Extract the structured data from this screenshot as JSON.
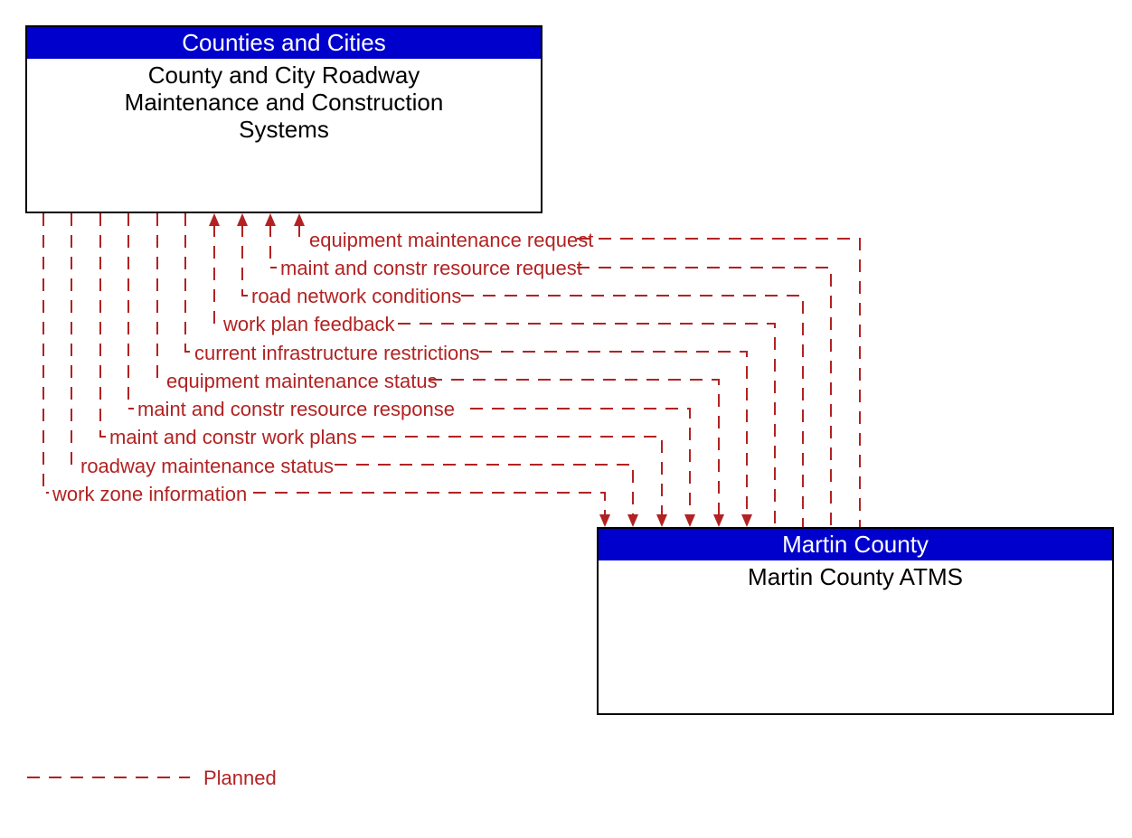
{
  "nodes": {
    "top": {
      "header": "Counties and Cities",
      "body_line1": "County and City Roadway",
      "body_line2": "Maintenance and Construction",
      "body_line3": "Systems"
    },
    "bottom": {
      "header": "Martin County",
      "body_line1": "Martin County ATMS"
    }
  },
  "flows_to_top": [
    "equipment maintenance request",
    "maint and constr resource request",
    "road network conditions",
    "work plan feedback"
  ],
  "flows_to_bottom": [
    "current infrastructure restrictions",
    "equipment maintenance status",
    "maint and constr resource response",
    "maint and constr work plans",
    "roadway maintenance status",
    "work zone information"
  ],
  "legend": {
    "planned": "Planned"
  },
  "colors": {
    "header_bg": "#0000cc",
    "flow": "#b22222"
  }
}
